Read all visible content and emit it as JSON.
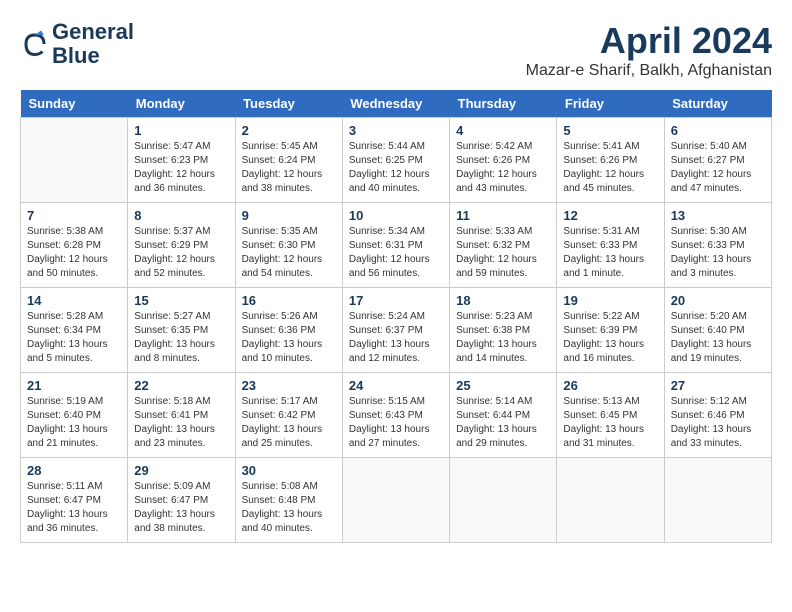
{
  "logo": {
    "line1": "General",
    "line2": "Blue"
  },
  "title": "April 2024",
  "subtitle": "Mazar-e Sharif, Balkh, Afghanistan",
  "days_header": [
    "Sunday",
    "Monday",
    "Tuesday",
    "Wednesday",
    "Thursday",
    "Friday",
    "Saturday"
  ],
  "weeks": [
    [
      {
        "day": "",
        "info": ""
      },
      {
        "day": "1",
        "info": "Sunrise: 5:47 AM\nSunset: 6:23 PM\nDaylight: 12 hours\nand 36 minutes."
      },
      {
        "day": "2",
        "info": "Sunrise: 5:45 AM\nSunset: 6:24 PM\nDaylight: 12 hours\nand 38 minutes."
      },
      {
        "day": "3",
        "info": "Sunrise: 5:44 AM\nSunset: 6:25 PM\nDaylight: 12 hours\nand 40 minutes."
      },
      {
        "day": "4",
        "info": "Sunrise: 5:42 AM\nSunset: 6:26 PM\nDaylight: 12 hours\nand 43 minutes."
      },
      {
        "day": "5",
        "info": "Sunrise: 5:41 AM\nSunset: 6:26 PM\nDaylight: 12 hours\nand 45 minutes."
      },
      {
        "day": "6",
        "info": "Sunrise: 5:40 AM\nSunset: 6:27 PM\nDaylight: 12 hours\nand 47 minutes."
      }
    ],
    [
      {
        "day": "7",
        "info": "Sunrise: 5:38 AM\nSunset: 6:28 PM\nDaylight: 12 hours\nand 50 minutes."
      },
      {
        "day": "8",
        "info": "Sunrise: 5:37 AM\nSunset: 6:29 PM\nDaylight: 12 hours\nand 52 minutes."
      },
      {
        "day": "9",
        "info": "Sunrise: 5:35 AM\nSunset: 6:30 PM\nDaylight: 12 hours\nand 54 minutes."
      },
      {
        "day": "10",
        "info": "Sunrise: 5:34 AM\nSunset: 6:31 PM\nDaylight: 12 hours\nand 56 minutes."
      },
      {
        "day": "11",
        "info": "Sunrise: 5:33 AM\nSunset: 6:32 PM\nDaylight: 12 hours\nand 59 minutes."
      },
      {
        "day": "12",
        "info": "Sunrise: 5:31 AM\nSunset: 6:33 PM\nDaylight: 13 hours\nand 1 minute."
      },
      {
        "day": "13",
        "info": "Sunrise: 5:30 AM\nSunset: 6:33 PM\nDaylight: 13 hours\nand 3 minutes."
      }
    ],
    [
      {
        "day": "14",
        "info": "Sunrise: 5:28 AM\nSunset: 6:34 PM\nDaylight: 13 hours\nand 5 minutes."
      },
      {
        "day": "15",
        "info": "Sunrise: 5:27 AM\nSunset: 6:35 PM\nDaylight: 13 hours\nand 8 minutes."
      },
      {
        "day": "16",
        "info": "Sunrise: 5:26 AM\nSunset: 6:36 PM\nDaylight: 13 hours\nand 10 minutes."
      },
      {
        "day": "17",
        "info": "Sunrise: 5:24 AM\nSunset: 6:37 PM\nDaylight: 13 hours\nand 12 minutes."
      },
      {
        "day": "18",
        "info": "Sunrise: 5:23 AM\nSunset: 6:38 PM\nDaylight: 13 hours\nand 14 minutes."
      },
      {
        "day": "19",
        "info": "Sunrise: 5:22 AM\nSunset: 6:39 PM\nDaylight: 13 hours\nand 16 minutes."
      },
      {
        "day": "20",
        "info": "Sunrise: 5:20 AM\nSunset: 6:40 PM\nDaylight: 13 hours\nand 19 minutes."
      }
    ],
    [
      {
        "day": "21",
        "info": "Sunrise: 5:19 AM\nSunset: 6:40 PM\nDaylight: 13 hours\nand 21 minutes."
      },
      {
        "day": "22",
        "info": "Sunrise: 5:18 AM\nSunset: 6:41 PM\nDaylight: 13 hours\nand 23 minutes."
      },
      {
        "day": "23",
        "info": "Sunrise: 5:17 AM\nSunset: 6:42 PM\nDaylight: 13 hours\nand 25 minutes."
      },
      {
        "day": "24",
        "info": "Sunrise: 5:15 AM\nSunset: 6:43 PM\nDaylight: 13 hours\nand 27 minutes."
      },
      {
        "day": "25",
        "info": "Sunrise: 5:14 AM\nSunset: 6:44 PM\nDaylight: 13 hours\nand 29 minutes."
      },
      {
        "day": "26",
        "info": "Sunrise: 5:13 AM\nSunset: 6:45 PM\nDaylight: 13 hours\nand 31 minutes."
      },
      {
        "day": "27",
        "info": "Sunrise: 5:12 AM\nSunset: 6:46 PM\nDaylight: 13 hours\nand 33 minutes."
      }
    ],
    [
      {
        "day": "28",
        "info": "Sunrise: 5:11 AM\nSunset: 6:47 PM\nDaylight: 13 hours\nand 36 minutes."
      },
      {
        "day": "29",
        "info": "Sunrise: 5:09 AM\nSunset: 6:47 PM\nDaylight: 13 hours\nand 38 minutes."
      },
      {
        "day": "30",
        "info": "Sunrise: 5:08 AM\nSunset: 6:48 PM\nDaylight: 13 hours\nand 40 minutes."
      },
      {
        "day": "",
        "info": ""
      },
      {
        "day": "",
        "info": ""
      },
      {
        "day": "",
        "info": ""
      },
      {
        "day": "",
        "info": ""
      }
    ]
  ]
}
